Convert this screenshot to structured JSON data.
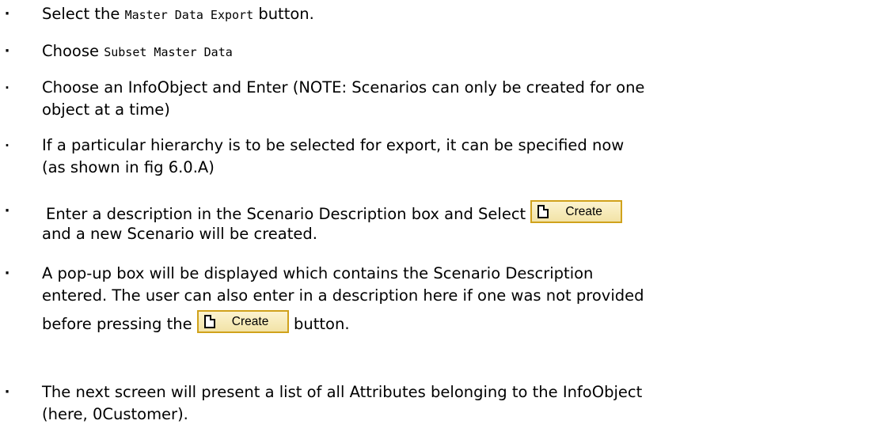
{
  "bullets": [
    {
      "marker": "·",
      "pre": "Select the ",
      "code": "Master Data Export",
      "post": " button."
    },
    {
      "marker": "·",
      "pre": "Choose ",
      "code": "Subset Master Data"
    },
    {
      "marker": "·",
      "line1": "Choose an InfoObject and Enter (NOTE: Scenarios can only be created for one",
      "line2": "object at a time)"
    },
    {
      "marker": "·",
      "line1": "If a particular hierarchy is to be selected for export, it can be specified now",
      "line2": "(as shown in fig 6.0.A)"
    },
    {
      "marker": "·",
      "line1": "Enter a description in the Scenario Description box and Select",
      "line2": "and a new Scenario will be created."
    },
    {
      "marker": "·",
      "line1": "A pop-up box will be displayed which contains the Scenario Description",
      "line2": "entered. The user can also enter in a description here if one was not provided",
      "line3_pre": "before pressing the",
      "line3_post": "button."
    },
    {
      "marker": "·",
      "line1": "The next screen will present a list of all Attributes belonging to the InfoObject",
      "line2": "(here, 0Customer)."
    }
  ],
  "create_button": {
    "label": "Create",
    "icon": "document-icon"
  }
}
